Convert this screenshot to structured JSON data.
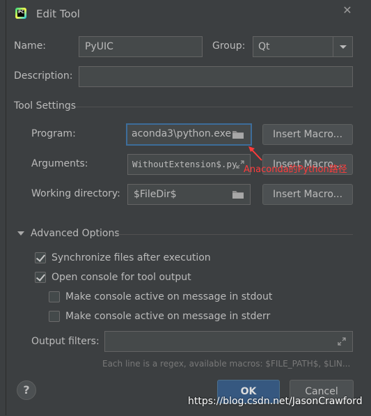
{
  "window": {
    "title": "Edit Tool",
    "close_glyph": "✕"
  },
  "fields": {
    "name_label": "Name:",
    "name_value": "PyUIC",
    "group_label": "Group:",
    "group_value": "Qt",
    "description_label": "Description:",
    "description_value": ""
  },
  "tool_settings": {
    "title": "Tool Settings",
    "program_label": "Program:",
    "program_value": "aconda3\\python.exe",
    "arguments_label": "Arguments:",
    "arguments_value": "WithoutExtension$.py",
    "working_dir_label": "Working directory:",
    "working_dir_value": "$FileDir$",
    "insert_macro_label": "Insert Macro..."
  },
  "advanced": {
    "title": "Advanced Options",
    "options": [
      {
        "label": "Synchronize files after execution",
        "checked": true
      },
      {
        "label": "Open console for tool output",
        "checked": true
      },
      {
        "label": "Make console active on message in stdout",
        "checked": false
      },
      {
        "label": "Make console active on message in stderr",
        "checked": false
      }
    ],
    "output_filters_label": "Output filters:",
    "output_filters_value": "",
    "hint": "Each line is a regex, available macros: $FILE_PATH$, $LIN..."
  },
  "footer": {
    "help_glyph": "?",
    "ok_label": "OK",
    "cancel_label": "Cancel"
  },
  "annotation": {
    "text": "Anaconda的Python路径",
    "color": "#ff3b3b"
  },
  "watermark": {
    "text": "https://blog.csdn.net/JasonCrawford"
  },
  "colors": {
    "background": "#3c3f41",
    "field_bg": "#45494a",
    "focus_border": "#3d6d9a",
    "primary_button": "#365880"
  },
  "icons": [
    "pycharm-logo-icon",
    "close-icon",
    "chevron-down-icon",
    "folder-icon",
    "expand-icon",
    "checkbox-icon",
    "help-icon"
  ]
}
